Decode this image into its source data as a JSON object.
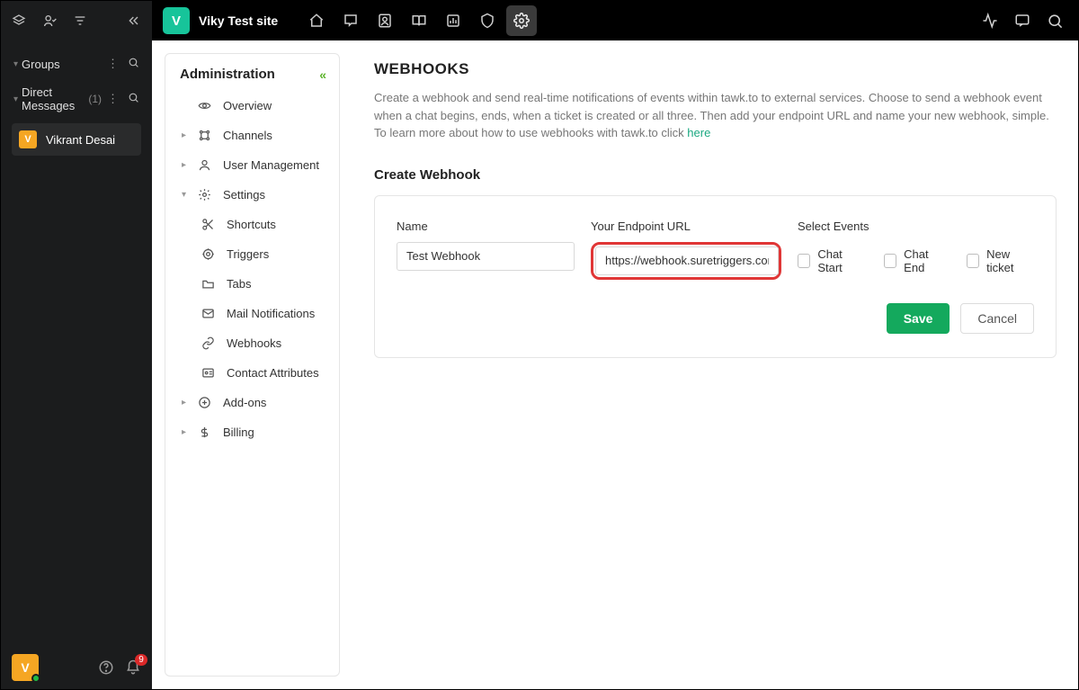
{
  "dark_sidebar": {
    "groups": {
      "label": "Groups"
    },
    "dm": {
      "label": "Direct Messages",
      "count": "(1)"
    },
    "dm_item": {
      "initial": "V",
      "name": "Vikrant Desai"
    },
    "bottom": {
      "initial": "V",
      "badge": "9"
    }
  },
  "topbar": {
    "site_initial": "V",
    "site_name": "Viky Test site"
  },
  "admin": {
    "heading": "Administration",
    "items": {
      "overview": "Overview",
      "channels": "Channels",
      "user_mgmt": "User Management",
      "settings": "Settings",
      "shortcuts": "Shortcuts",
      "triggers": "Triggers",
      "tabs": "Tabs",
      "mail": "Mail Notifications",
      "webhooks": "Webhooks",
      "contact_attr": "Contact Attributes",
      "addons": "Add-ons",
      "billing": "Billing"
    }
  },
  "page": {
    "title": "WEBHOOKS",
    "desc": "Create a webhook and send real-time notifications of events within tawk.to to external services. Choose to send a webhook event when a chat begins, ends, when a ticket is created or all three. Then add your endpoint URL and name your new webhook, simple. To learn more about how to use webhooks with tawk.to click ",
    "desc_link": "here",
    "create_title": "Create Webhook"
  },
  "form": {
    "name_label": "Name",
    "name_value": "Test Webhook",
    "url_label": "Your Endpoint URL",
    "url_value": "https://webhook.suretriggers.com/taw",
    "events_label": "Select Events",
    "chat_start": "Chat Start",
    "chat_end": "Chat End",
    "new_ticket": "New ticket",
    "save": "Save",
    "cancel": "Cancel"
  }
}
